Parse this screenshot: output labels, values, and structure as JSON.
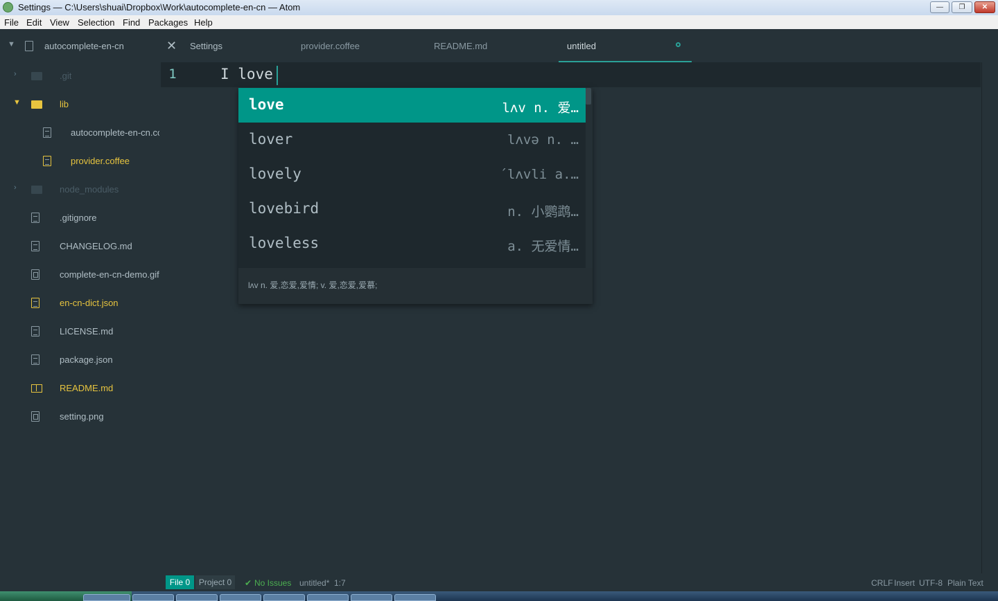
{
  "window": {
    "title": "Settings — C:\\Users\\shuai\\Dropbox\\Work\\autocomplete-en-cn — Atom",
    "controls": {
      "minimize": "—",
      "maximize": "❐",
      "close": "✕"
    }
  },
  "menu": [
    "File",
    "Edit",
    "View",
    "Selection",
    "Find",
    "Packages",
    "Help"
  ],
  "project": {
    "name": "autocomplete-en-cn"
  },
  "tree": {
    "git": ".git",
    "lib": "lib",
    "autocomplete": "autocomplete-en-cn.cc",
    "provider": "provider.coffee",
    "node_modules": "node_modules",
    "gitignore": ".gitignore",
    "changelog": "CHANGELOG.md",
    "demo_gif": "complete-en-cn-demo.gif",
    "dict": "en-cn-dict.json",
    "license": "LICENSE.md",
    "package": "package.json",
    "readme": "README.md",
    "setting": "setting.png"
  },
  "tabs": {
    "settings": "Settings",
    "provider": "provider.coffee",
    "readme": "README.md",
    "untitled": "untitled"
  },
  "editor": {
    "line_number": "1",
    "text": "I love"
  },
  "autocomplete": {
    "suggestions": [
      {
        "word": "love",
        "right": "lʌv n. 爱…"
      },
      {
        "word": "lover",
        "right": "lʌvə n. …"
      },
      {
        "word": "lovely",
        "right": "´lʌvli a.…"
      },
      {
        "word": "lovebird",
        "right": "n. 小鹦鹉…"
      },
      {
        "word": "loveless",
        "right": "a. 无爱情…"
      }
    ],
    "description": "lʌv n. 爱,恋爱,爱情; v. 爱,恋爱,爱慕;"
  },
  "status": {
    "file": "File 0",
    "project": "Project 0",
    "check_icon": "✔",
    "issues": "No Issues",
    "filename": "untitled*",
    "cursor": "1:7",
    "line_ending": "CRLF",
    "mode": "Insert",
    "encoding": "UTF-8",
    "grammar": "Plain Text"
  },
  "colors": {
    "background": "#263238",
    "accent": "#009688",
    "highlight": "#e7c43f"
  }
}
